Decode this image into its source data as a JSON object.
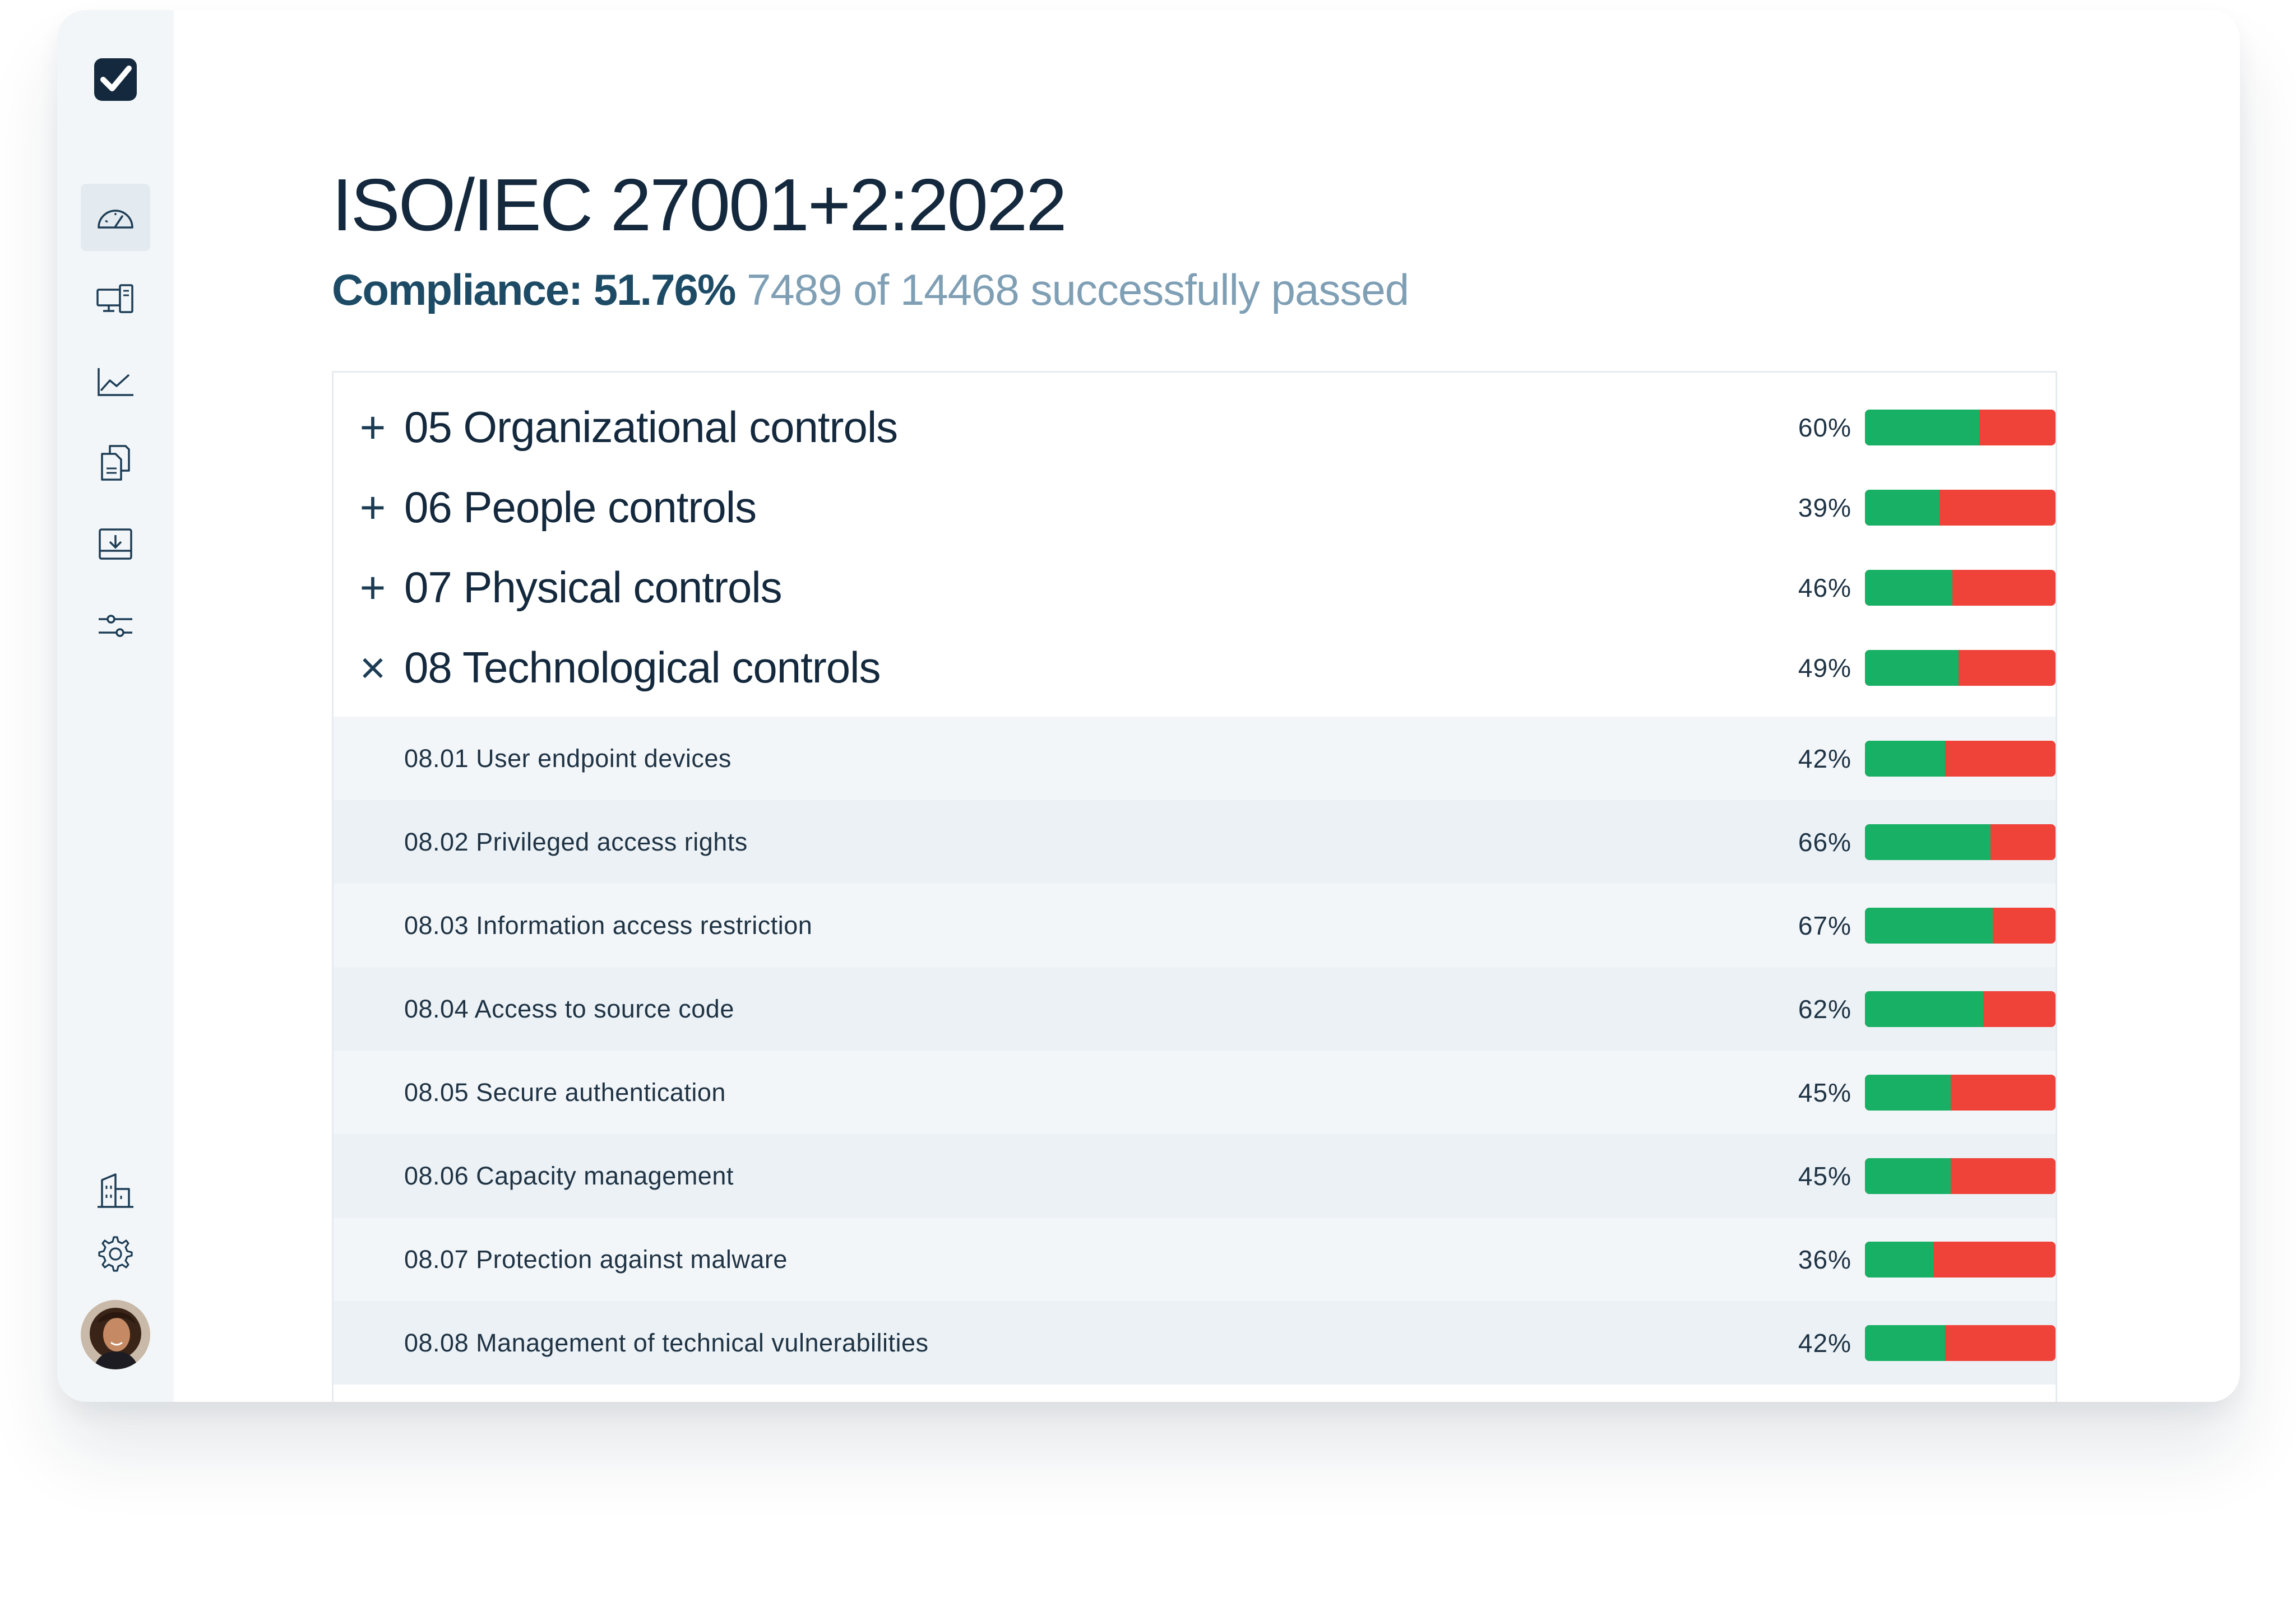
{
  "header": {
    "title": "ISO/IEC 27001+2:2022",
    "compliance_label": "Compliance:",
    "compliance_value": "51.76%",
    "passed_text": "7489 of 14468 successfully passed",
    "compliance_fraction": 0.5176
  },
  "sidebar": {
    "logo_icon": "checkbox-logo-icon",
    "items": [
      {
        "icon": "dashboard-gauge-icon",
        "active": true
      },
      {
        "icon": "devices-icon",
        "active": false
      },
      {
        "icon": "line-chart-icon",
        "active": false
      },
      {
        "icon": "documents-icon",
        "active": false
      },
      {
        "icon": "download-tray-icon",
        "active": false
      },
      {
        "icon": "sliders-icon",
        "active": false
      }
    ],
    "bottom_items": [
      {
        "icon": "building-icon"
      },
      {
        "icon": "gear-icon"
      }
    ],
    "avatar": "user-avatar"
  },
  "groups": [
    {
      "toggle": "+",
      "label": "05 Organizational controls",
      "percent_label": "60%",
      "percent": 60,
      "expanded": false
    },
    {
      "toggle": "+",
      "label": "06 People controls",
      "percent_label": "39%",
      "percent": 39,
      "expanded": false
    },
    {
      "toggle": "+",
      "label": "07 Physical controls",
      "percent_label": "46%",
      "percent": 46,
      "expanded": false
    },
    {
      "toggle": "×",
      "label": "08 Technological controls",
      "percent_label": "49%",
      "percent": 49,
      "expanded": true
    }
  ],
  "subcontrols": [
    {
      "label": "08.01 User endpoint devices",
      "percent_label": "42%",
      "percent": 42
    },
    {
      "label": "08.02 Privileged access rights",
      "percent_label": "66%",
      "percent": 66
    },
    {
      "label": "08.03 Information access restriction",
      "percent_label": "67%",
      "percent": 67
    },
    {
      "label": "08.04 Access to source code",
      "percent_label": "62%",
      "percent": 62
    },
    {
      "label": "08.05 Secure authentication",
      "percent_label": "45%",
      "percent": 45
    },
    {
      "label": "08.06 Capacity management",
      "percent_label": "45%",
      "percent": 45
    },
    {
      "label": "08.07 Protection against malware",
      "percent_label": "36%",
      "percent": 36
    },
    {
      "label": "08.08 Management of technical vulnerabilities",
      "percent_label": "42%",
      "percent": 42
    }
  ],
  "colors": {
    "pass": "#18b064",
    "fail": "#ef4239",
    "title": "#14293d",
    "accent": "#1d4b66",
    "muted": "#7f9fb5"
  }
}
